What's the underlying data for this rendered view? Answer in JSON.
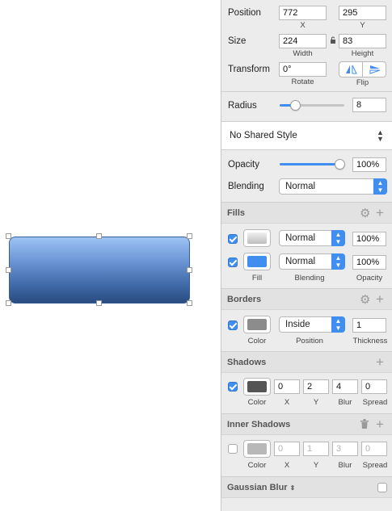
{
  "colors": {
    "accent": "#3f8ef0",
    "shape_top": "#9ec3f4",
    "shape_bottom": "#2a4c80"
  },
  "position": {
    "label": "Position",
    "x": "772",
    "y": "295",
    "x_caption": "X",
    "y_caption": "Y"
  },
  "size": {
    "label": "Size",
    "width": "224",
    "height": "83",
    "width_caption": "Width",
    "height_caption": "Height"
  },
  "transform": {
    "label": "Transform",
    "rotate": "0°",
    "rotate_caption": "Rotate",
    "flip_caption": "Flip"
  },
  "radius": {
    "label": "Radius",
    "value": "8",
    "slider_fraction": 0.1
  },
  "shared_style": {
    "value": "No Shared Style"
  },
  "opacity": {
    "label": "Opacity",
    "value": "100%",
    "slider_fraction": 1.0
  },
  "blending": {
    "label": "Blending",
    "value": "Normal"
  },
  "fills": {
    "title": "Fills",
    "rows": [
      {
        "blend": "Normal",
        "opacity": "100%",
        "color": "#d4d4d4",
        "checked": true
      },
      {
        "blend": "Normal",
        "opacity": "100%",
        "color": "#3f8ef0",
        "checked": true
      }
    ],
    "captions": {
      "fill": "Fill",
      "blending": "Blending",
      "opacity": "Opacity"
    }
  },
  "borders": {
    "title": "Borders",
    "position": "Inside",
    "thickness": "1",
    "color": "#8c8c8c",
    "captions": {
      "color": "Color",
      "position": "Position",
      "thickness": "Thickness"
    }
  },
  "shadows": {
    "title": "Shadows",
    "x": "0",
    "y": "2",
    "blur": "4",
    "spread": "0",
    "color": "#555555",
    "captions": {
      "color": "Color",
      "x": "X",
      "y": "Y",
      "blur": "Blur",
      "spread": "Spread"
    }
  },
  "inner_shadows": {
    "title": "Inner Shadows",
    "x": "0",
    "y": "1",
    "blur": "3",
    "spread": "0",
    "color": "#b8b8b8",
    "captions": {
      "color": "Color",
      "x": "X",
      "y": "Y",
      "blur": "Blur",
      "spread": "Spread"
    }
  },
  "gaussian_blur": {
    "title": "Gaussian Blur"
  }
}
